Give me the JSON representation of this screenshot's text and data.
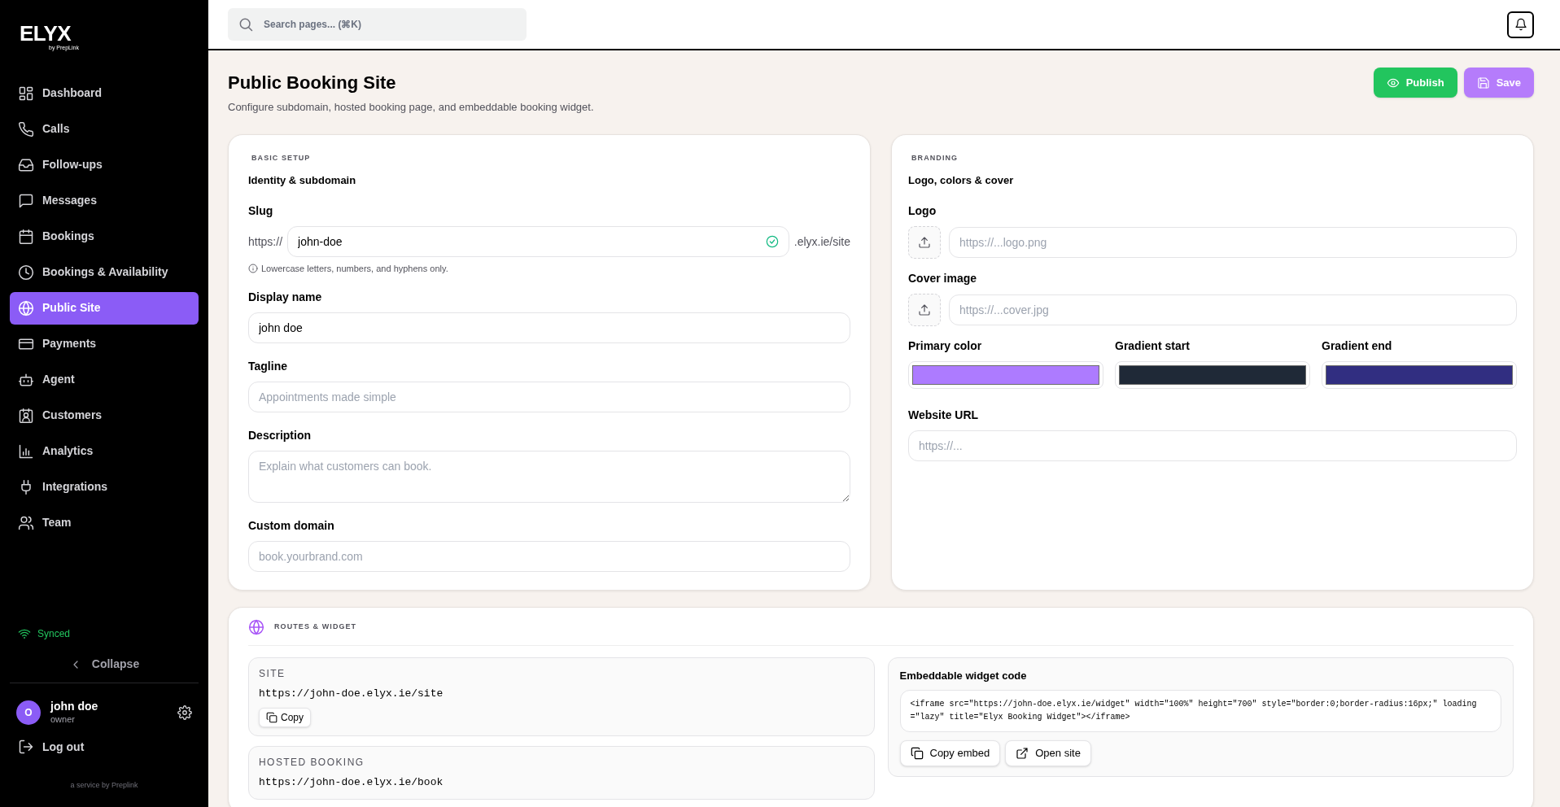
{
  "brand": {
    "logo": "ELYX",
    "byline": "by PrepLink"
  },
  "sidebar": {
    "items": [
      {
        "label": "Dashboard",
        "selected": false
      },
      {
        "label": "Calls",
        "selected": false
      },
      {
        "label": "Follow-ups",
        "selected": false
      },
      {
        "label": "Messages",
        "selected": false
      },
      {
        "label": "Bookings",
        "selected": false
      },
      {
        "label": "Bookings & Availability",
        "selected": false
      },
      {
        "label": "Public Site",
        "selected": true
      },
      {
        "label": "Payments",
        "selected": false
      },
      {
        "label": "Agent",
        "selected": false
      },
      {
        "label": "Customers",
        "selected": false
      },
      {
        "label": "Analytics",
        "selected": false
      },
      {
        "label": "Integrations",
        "selected": false
      },
      {
        "label": "Team",
        "selected": false
      }
    ],
    "sync_status": "Synced",
    "collapse": "Collapse",
    "user": {
      "initial": "O",
      "name": "john doe",
      "role": "owner"
    },
    "logout": "Log out",
    "footer": "a service by Preplink"
  },
  "header": {
    "search": {
      "placeholder": "Search pages... (⌘K)"
    }
  },
  "page": {
    "title": "Public Booking Site",
    "subtitle": "Configure subdomain, hosted booking page, and embeddable booking widget.",
    "buttons": [
      {
        "label": "Publish",
        "kind": "publish"
      },
      {
        "label": "Save",
        "kind": "save"
      }
    ]
  },
  "basic_setup": {
    "eyebrow": "BASIC SETUP",
    "heading": "Identity & subdomain",
    "slug": {
      "label": "Slug",
      "prefix": "https://",
      "value": "john-doe",
      "valid": true,
      "suffix": ".elyx.ie/site",
      "hint": "Lowercase letters, numbers, and hyphens only."
    },
    "fields": [
      {
        "label": "Display name",
        "kind": "input",
        "value": "john doe"
      },
      {
        "label": "Tagline",
        "kind": "input",
        "placeholder": "Appointments made simple"
      },
      {
        "label": "Description",
        "kind": "textarea",
        "placeholder": "Explain what customers can book."
      },
      {
        "label": "Custom domain",
        "kind": "input",
        "placeholder": "book.yourbrand.com"
      }
    ]
  },
  "branding": {
    "eyebrow": "BRANDING",
    "heading": "Logo, colors & cover",
    "uploads": [
      {
        "label": "Logo",
        "placeholder": "https://...logo.png"
      },
      {
        "label": "Cover image",
        "placeholder": "https://...cover.jpg"
      }
    ],
    "colors": [
      {
        "label": "Primary color",
        "color": "#ad7bff"
      },
      {
        "label": "Gradient start",
        "color": "#1f2937"
      },
      {
        "label": "Gradient end",
        "color": "#312e81"
      }
    ],
    "website": {
      "label": "Website URL",
      "placeholder": "https://..."
    }
  },
  "routes": {
    "eyebrow": "ROUTES & WIDGET",
    "links": [
      {
        "label": "SITE",
        "url": "https://john-doe.elyx.ie/site",
        "button": "Copy"
      },
      {
        "label": "HOSTED BOOKING",
        "url": "https://john-doe.elyx.ie/book"
      }
    ],
    "embed": {
      "heading": "Embeddable widget code",
      "code": "<iframe src=\"https://john-doe.elyx.ie/widget\" width=\"100%\" height=\"700\" style=\"border:0;border-radius:16px;\" loading=\"lazy\" title=\"Elyx Booking Widget\"></iframe>",
      "buttons": [
        {
          "label": "Copy embed",
          "kind": "copy"
        },
        {
          "label": "Open site",
          "kind": "open"
        }
      ]
    }
  }
}
